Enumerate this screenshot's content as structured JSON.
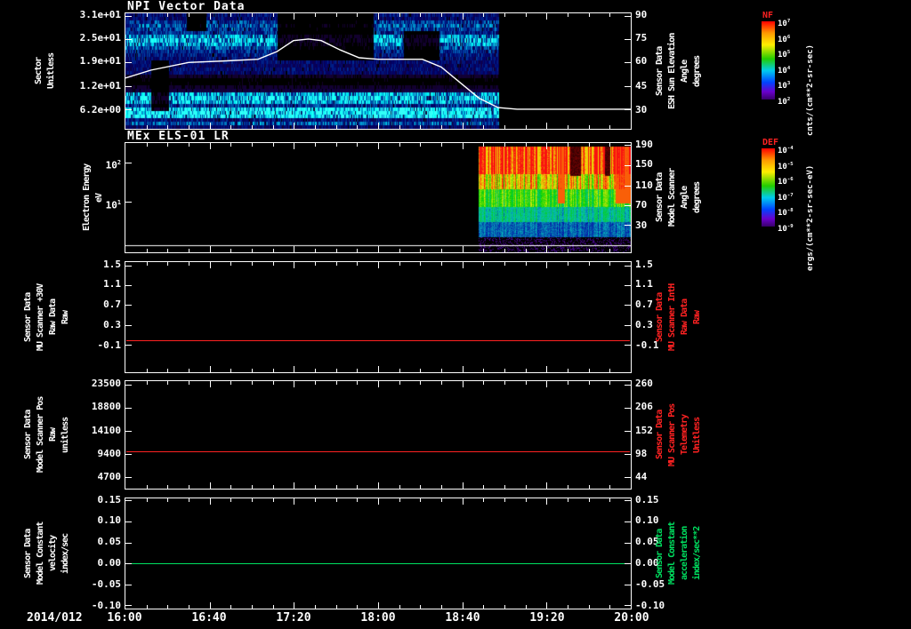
{
  "date_label": "2014/012",
  "x_axis": {
    "tick_labels": [
      "16:00",
      "16:40",
      "17:20",
      "18:00",
      "18:40",
      "19:20",
      "20:00"
    ]
  },
  "colorbars": [
    {
      "name": "NF",
      "name_color": "#ff2222",
      "unit": "cnts/(cm**2-sr-sec)",
      "tick_labels": [
        "10^7",
        "10^6",
        "10^5",
        "10^4",
        "10^3",
        "10^2"
      ]
    },
    {
      "name": "DEF",
      "name_color": "#ff2222",
      "unit": "ergs/(cm**2-sr-sec-eV)",
      "tick_labels": [
        "10^-4",
        "10^-5",
        "10^-6",
        "10^-7",
        "10^-8",
        "10^-9"
      ]
    }
  ],
  "chart_data": [
    {
      "type": "heatmap",
      "title": "NPI Vector Data",
      "ylabel_lines": [
        "Sector",
        "Unitless"
      ],
      "y_tick_labels": [
        "3.1e+01",
        "2.5e+01",
        "1.9e+01",
        "1.2e+01",
        "6.2e+00"
      ],
      "y_tick_pos": [
        0.02,
        0.22,
        0.42,
        0.63,
        0.83
      ],
      "right_axis": {
        "label_lines": [
          "Sensor Data",
          "ESH Sun Elevation",
          "Angle",
          "degrees"
        ],
        "color": "#ffffff",
        "tick_labels": [
          "90",
          "75",
          "60",
          "45",
          "30"
        ],
        "tick_pos": [
          0.02,
          0.22,
          0.42,
          0.63,
          0.83
        ]
      },
      "colorbar": "NF",
      "x_range_hours": [
        16,
        20
      ],
      "data_end_frac": 0.74,
      "row_profile": [
        0.3,
        0.28,
        0.42,
        0.48,
        0.42,
        0.38,
        0.6,
        0.72,
        0.6,
        0.45,
        0.38,
        0.33,
        0.3,
        0.28,
        0.25,
        0.28,
        0.26,
        0.06,
        0.03,
        0.03,
        0.06,
        0.1,
        0.62,
        0.78,
        0.68,
        0.4,
        0.85,
        0.92,
        0.8,
        0.3,
        0.48,
        0.25
      ],
      "blotches": [
        {
          "t0": 0.3,
          "t1": 0.49,
          "r0": 0,
          "r1": 12
        },
        {
          "t0": 0.05,
          "t1": 0.085,
          "r0": 13,
          "r1": 26
        },
        {
          "t0": 0.55,
          "t1": 0.62,
          "r0": 5,
          "r1": 12
        },
        {
          "t0": 0.12,
          "t1": 0.16,
          "r0": 0,
          "r1": 4
        }
      ],
      "overlay_line": {
        "name": "ESH Sun Elevation Angle",
        "color": "#ffffff",
        "points_hours_degrees": [
          [
            16.0,
            50
          ],
          [
            16.2,
            55
          ],
          [
            16.5,
            60
          ],
          [
            16.8,
            61
          ],
          [
            17.05,
            62
          ],
          [
            17.2,
            67
          ],
          [
            17.33,
            74
          ],
          [
            17.45,
            75
          ],
          [
            17.55,
            74
          ],
          [
            17.7,
            68
          ],
          [
            17.85,
            63
          ],
          [
            18.0,
            62
          ],
          [
            18.35,
            62
          ],
          [
            18.5,
            57
          ],
          [
            18.65,
            47
          ],
          [
            18.8,
            37
          ],
          [
            18.95,
            31
          ],
          [
            19.1,
            30
          ],
          [
            20.0,
            30
          ]
        ]
      }
    },
    {
      "type": "heatmap",
      "title": "MEx ELS-01 LR",
      "ylabel_lines": [
        "Electron Energy",
        "eV"
      ],
      "y_tick_labels": [
        "10^2",
        "10^1"
      ],
      "y_tick_pos": [
        0.18,
        0.54
      ],
      "right_axis": {
        "label_lines": [
          "Sensor Data",
          "Model Scanner",
          "Angle",
          "degrees"
        ],
        "color": "#ffffff",
        "tick_labels": [
          "190",
          "150",
          "110",
          "70",
          "30"
        ],
        "tick_pos": [
          0.02,
          0.2,
          0.39,
          0.57,
          0.75
        ]
      },
      "colorbar": "DEF",
      "data_start_frac": 0.7,
      "profile_breaks": [
        0.28,
        0.42,
        0.58,
        0.72,
        0.86
      ],
      "profile_values": [
        0.97,
        0.8,
        0.6,
        0.4,
        0.24,
        0.12
      ],
      "dark_streaks": [
        [
          0.6,
          0.67
        ],
        [
          0.83,
          0.865
        ]
      ],
      "hot_streaks": [
        [
          0.52,
          0.565
        ],
        [
          0.9,
          1.0
        ]
      ],
      "baseline_frac": 0.935
    },
    {
      "type": "line",
      "ylabel_lines": [
        "Sensor Data",
        "MU Scanner +30V",
        "Raw Data",
        "Raw"
      ],
      "y_tick_labels": [
        "1.5",
        "1.1",
        "0.7",
        "0.3",
        "-0.1"
      ],
      "y_tick_pos": [
        0.03,
        0.21,
        0.39,
        0.57,
        0.75
      ],
      "right_axis": {
        "label_lines": [
          "Sensor Data",
          "MU Scanner IntH",
          "Raw Data",
          "Raw"
        ],
        "color": "#ff2222",
        "tick_labels": [
          "1.5",
          "1.1",
          "0.7",
          "0.3",
          "-0.1"
        ],
        "tick_pos": [
          0.03,
          0.21,
          0.39,
          0.57,
          0.75
        ]
      },
      "series": [
        {
          "name": "MU Scanner +30V Raw Data",
          "color": "#ff2222",
          "value": 0.0,
          "pos": 0.71
        }
      ]
    },
    {
      "type": "line",
      "ylabel_lines": [
        "Sensor Data",
        "Model Scanner Pos",
        "Raw",
        "unitless"
      ],
      "y_tick_labels": [
        "23500",
        "18800",
        "14100",
        "9400",
        "4700"
      ],
      "y_tick_pos": [
        0.03,
        0.245,
        0.46,
        0.675,
        0.89
      ],
      "right_axis": {
        "label_lines": [
          "Sensor Data",
          "MU Scanner Pos",
          "Telemetry",
          "Unitless"
        ],
        "color": "#ff2222",
        "tick_labels": [
          "260",
          "206",
          "152",
          "98",
          "44"
        ],
        "tick_pos": [
          0.03,
          0.245,
          0.46,
          0.675,
          0.89
        ]
      },
      "series": [
        {
          "name": "Model Scanner Pos Raw",
          "color": "#ff2222",
          "value": 9800,
          "pos": 0.655
        }
      ]
    },
    {
      "type": "line",
      "ylabel_lines": [
        "Sensor Data",
        "Model Constant",
        "velocity",
        "index/sec"
      ],
      "y_tick_labels": [
        "0.15",
        "0.10",
        "0.05",
        "0.00",
        "-0.05",
        "-0.10"
      ],
      "y_tick_pos": [
        0.02,
        0.21,
        0.4,
        0.59,
        0.78,
        0.97
      ],
      "right_axis": {
        "label_lines": [
          "Sensor Data",
          "Model Constant",
          "acceleration",
          "index/sec**2"
        ],
        "color": "#00e060",
        "tick_labels": [
          "0.15",
          "0.10",
          "0.05",
          "0.00",
          "-0.05",
          "-0.10"
        ],
        "tick_pos": [
          0.02,
          0.21,
          0.4,
          0.59,
          0.78,
          0.97
        ]
      },
      "series": [
        {
          "name": "Model Constant velocity",
          "color": "#00e060",
          "value": 0.0,
          "pos": 0.59
        }
      ]
    }
  ]
}
